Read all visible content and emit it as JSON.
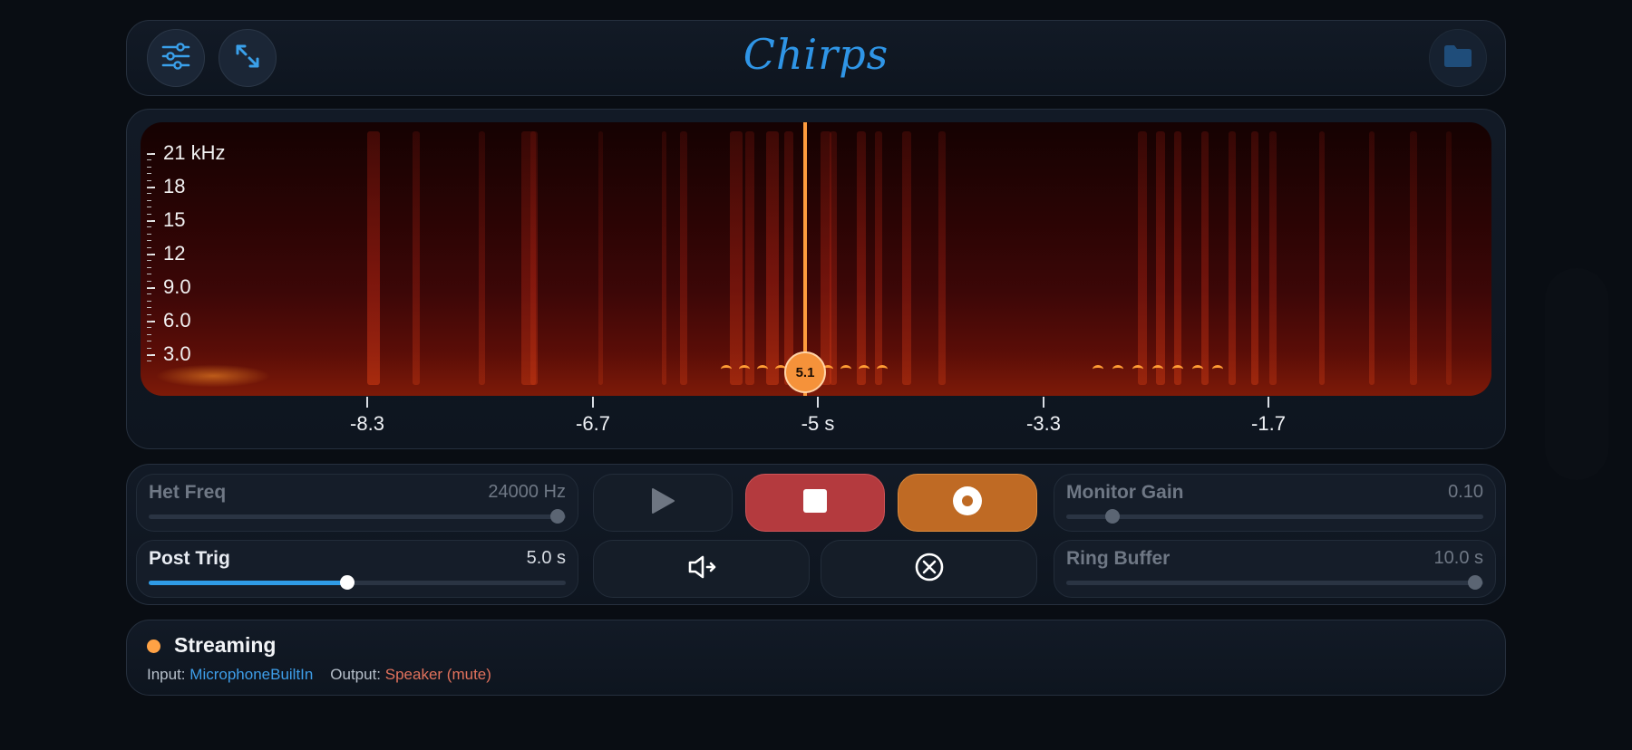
{
  "header": {
    "title": "Chirps",
    "buttons": [
      {
        "name": "settings-button",
        "icon": "sliders-icon"
      },
      {
        "name": "expand-button",
        "icon": "expand-arrows-icon"
      },
      {
        "name": "folder-button",
        "icon": "folder-icon"
      }
    ]
  },
  "spectrogram": {
    "freq_labels": [
      "21 kHz",
      "18",
      "15",
      "12",
      "9.0",
      "6.0",
      "3.0"
    ],
    "time_labels": [
      "-8.3",
      "-6.7",
      "-5 s",
      "-3.3",
      "-1.7"
    ],
    "playhead_value": "5.1",
    "colors": {
      "accent": "#ff9c3d",
      "low": "#150202",
      "high": "#7d1a08"
    }
  },
  "controls": {
    "het_freq": {
      "label": "Het Freq",
      "value": "24000 Hz",
      "fraction": 0.98
    },
    "post_trig": {
      "label": "Post Trig",
      "value": "5.0 s",
      "fraction": 0.475
    },
    "monitor_gain": {
      "label": "Monitor Gain",
      "value": "0.10",
      "fraction": 0.11
    },
    "ring_buffer": {
      "label": "Ring Buffer",
      "value": "10.0 s",
      "fraction": 0.98
    },
    "buttons": [
      {
        "name": "play",
        "icon": "play-icon"
      },
      {
        "name": "stop",
        "icon": "stop-icon",
        "color": "#b43a3e"
      },
      {
        "name": "record",
        "icon": "record-icon",
        "color": "#bf6a24"
      },
      {
        "name": "monitor",
        "icon": "speaker-icon"
      },
      {
        "name": "cancel",
        "icon": "cancel-circle-icon"
      }
    ]
  },
  "status": {
    "state": "Streaming",
    "input_label": "Input:",
    "input_value": "MicrophoneBuiltIn",
    "output_label": "Output:",
    "output_value": "Speaker (mute)",
    "dot_color": "#ffa245"
  }
}
